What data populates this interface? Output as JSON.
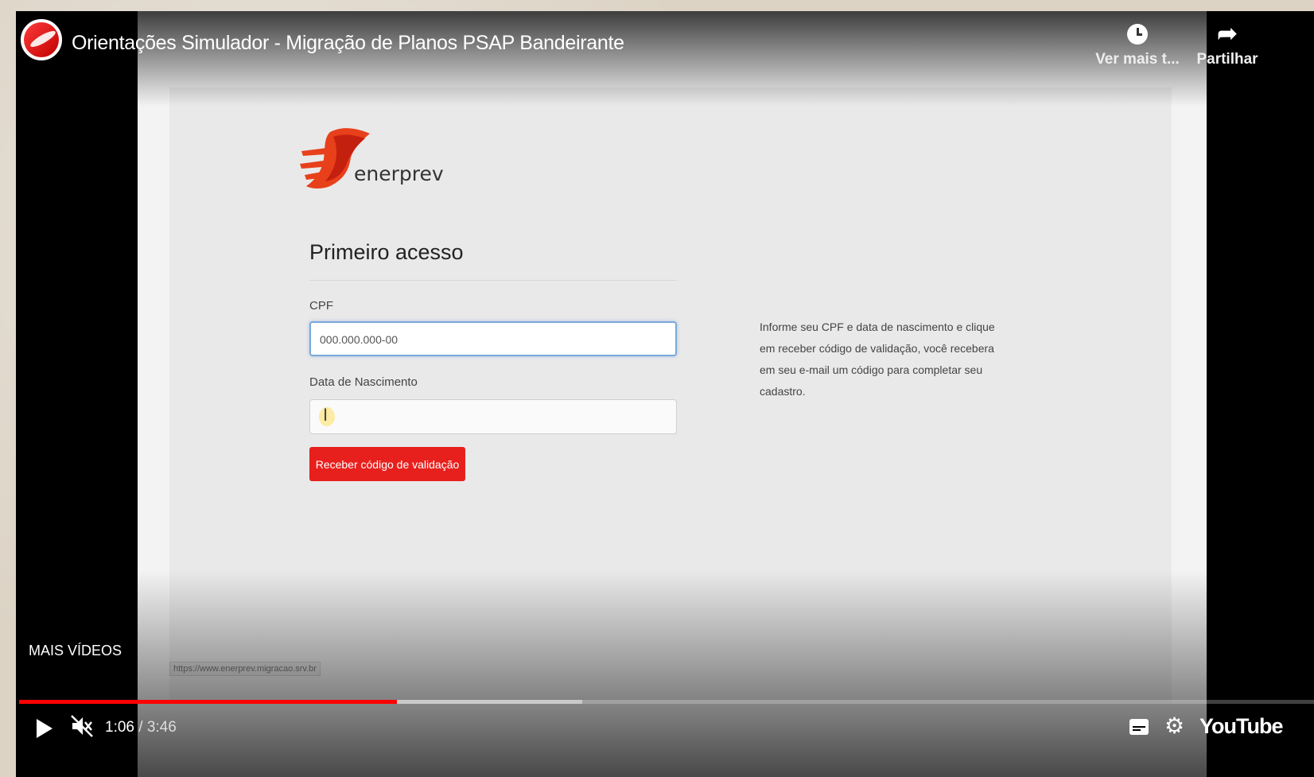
{
  "player": {
    "title": "Orientações Simulador - Migração de Planos PSAP Bandeirante",
    "watch_later_label": "Ver mais t...",
    "share_label": "Partilhar",
    "more_videos_label": "MAIS VÍDEOS",
    "current_time": "1:06",
    "duration": "/ 3:46",
    "youtube_label": "YouTube",
    "progress_fraction": 0.292,
    "buffer_fraction": 0.435,
    "colors": {
      "progress": "#ff0000",
      "background": "#000000"
    }
  },
  "page": {
    "logo_text": "enerprev",
    "heading": "Primeiro acesso",
    "cpf_label": "CPF",
    "cpf_value": "000.000.000-00",
    "dob_label": "Data de Nascimento",
    "dob_value": "",
    "submit_label": "Receber código de validação",
    "help_text": "Informe seu CPF e data de nascimento e clique em receber código de validação, você recebera em seu e-mail um código para completar seu cadastro.",
    "status_url": "https://www.enerprev.migracao.srv.br",
    "colors": {
      "accent": "#e8201d"
    }
  }
}
